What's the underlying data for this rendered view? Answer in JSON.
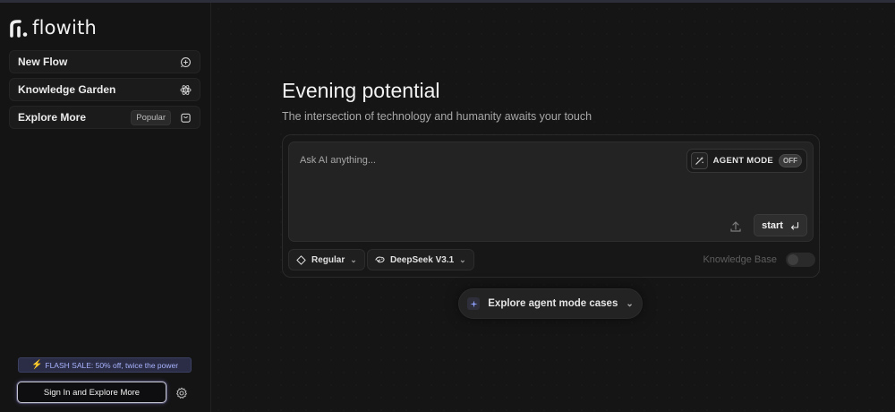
{
  "app": {
    "name": "flowith"
  },
  "sidebar": {
    "items": [
      {
        "label": "New Flow",
        "icon": "chat-plus-icon"
      },
      {
        "label": "Knowledge Garden",
        "icon": "atom-icon"
      },
      {
        "label": "Explore More",
        "badge": "Popular",
        "icon": "bag-icon"
      }
    ],
    "flash_sale": "FLASH SALE: 50% off, twice the power",
    "sign_in": "Sign In and Explore More",
    "settings_icon": "gear-icon"
  },
  "main": {
    "headline": "Evening potential",
    "subhead": "The intersection of technology and humanity awaits your touch",
    "composer": {
      "placeholder": "Ask AI anything...",
      "agent_mode_label": "AGENT MODE",
      "agent_mode_state": "OFF",
      "start_label": "start"
    },
    "mode_select": "Regular",
    "model_select": "DeepSeek V3.1",
    "knowledge_base_label": "Knowledge Base",
    "knowledge_base_enabled": false,
    "explore_cases": "Explore agent mode cases"
  },
  "colors": {
    "background": "#151515",
    "flash_bg": "#2a2d45",
    "flash_text": "#a9b3ff",
    "bolt": "#f79a3a"
  }
}
